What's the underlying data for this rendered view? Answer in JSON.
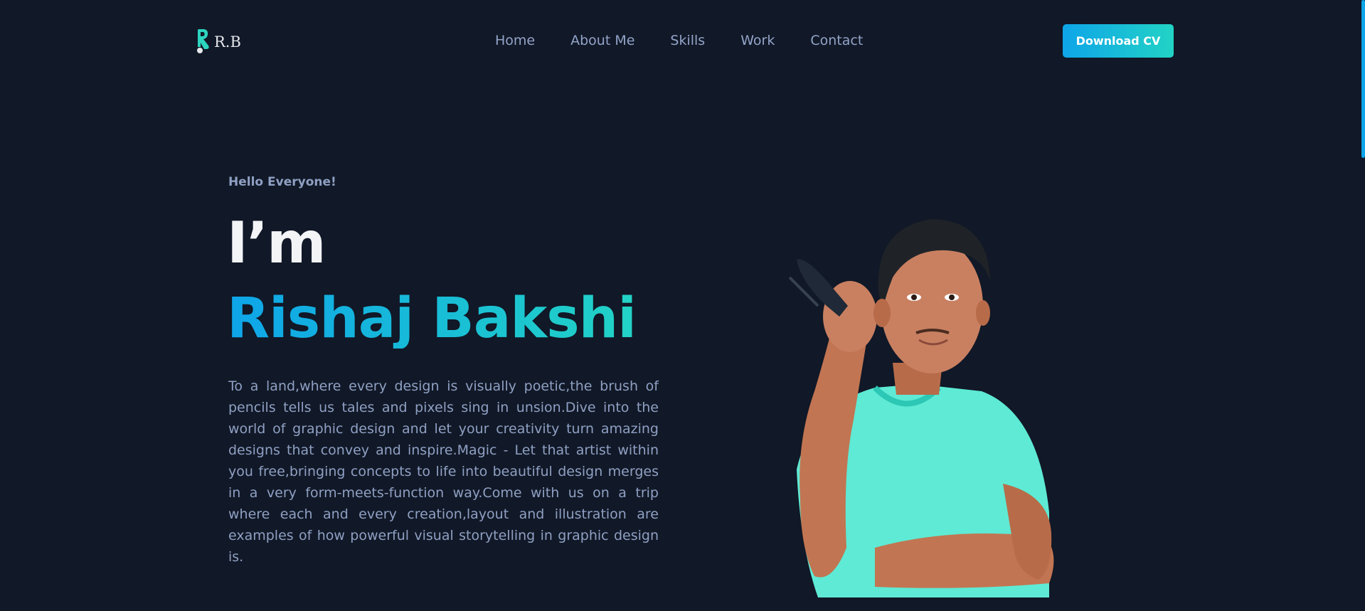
{
  "brand": {
    "logo_text": "R.B"
  },
  "nav": {
    "items": [
      {
        "label": "Home"
      },
      {
        "label": "About Me"
      },
      {
        "label": "Skills"
      },
      {
        "label": "Work"
      },
      {
        "label": "Contact"
      }
    ]
  },
  "header": {
    "cta_label": "Download CV"
  },
  "hero": {
    "greeting": "Hello Everyone!",
    "intro_word": "I’m",
    "name": "Rishaj Bakshi",
    "description": "To a land,where every design is visually poetic,the brush of pencils tells us tales and pixels sing in unsion.Dive into the world of graphic design and let your creativity turn amazing designs that convey and inspire.Magic - Let that artist within you free,bringing concepts to life into beautiful design merges in a very form-meets-function way.Come with us on a trip where each and every creation,layout and illustration are examples of how powerful visual storytelling in graphic design is."
  },
  "colors": {
    "background": "#111827",
    "accent_start": "#0ea5e9",
    "accent_end": "#22d3c5",
    "muted_text": "#8fa0c3"
  }
}
